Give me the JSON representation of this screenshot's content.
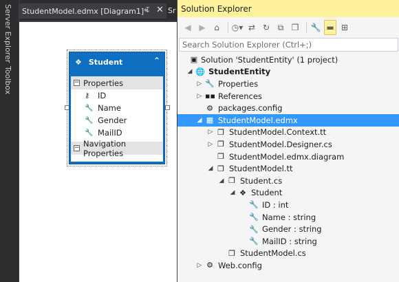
{
  "left_strip": {
    "server_explorer": "Server Explorer",
    "toolbox": "Toolbox"
  },
  "designer": {
    "tab_title": "StudentModel.edmx [Diagram1]*",
    "pin_glyph": "↧",
    "close_glyph": "✕",
    "next_tab_fragment": "Sr",
    "entity": {
      "name": "Student",
      "properties_label": "Properties",
      "properties": [
        "ID",
        "Name",
        "Gender",
        "MailID"
      ],
      "navigation_label": "Navigation Properties"
    }
  },
  "solution_explorer": {
    "title": "Solution Explorer",
    "search_placeholder": "Search Solution Explorer (Ctrl+;)",
    "toolbar_icons": [
      "back-icon",
      "forward-icon",
      "home-icon",
      "pending-changes-icon",
      "sync-icon",
      "refresh-icon",
      "collapse-all-icon",
      "show-all-files-icon",
      "properties-icon",
      "preview-icon",
      "class-view-icon"
    ],
    "tree": [
      {
        "label": "Solution 'StudentEntity' (1 project)",
        "level": 0,
        "expander": "",
        "icon": "solution-icon",
        "glyph": "▣",
        "bold": false,
        "selected": false
      },
      {
        "label": "StudentEntity",
        "level": 0,
        "expander": "◢",
        "icon": "web-project-icon",
        "glyph": "🌐",
        "bold": true,
        "selected": false
      },
      {
        "label": "Properties",
        "level": 1,
        "expander": "▷",
        "icon": "wrench-icon",
        "glyph": "🔧",
        "bold": false,
        "selected": false
      },
      {
        "label": "References",
        "level": 1,
        "expander": "▷",
        "icon": "references-icon",
        "glyph": "▪▪",
        "bold": false,
        "selected": false
      },
      {
        "label": "packages.config",
        "level": 1,
        "expander": "",
        "icon": "config-file-icon",
        "glyph": "⚙",
        "bold": false,
        "selected": false
      },
      {
        "label": "StudentModel.edmx",
        "level": 1,
        "expander": "◢",
        "icon": "edmx-file-icon",
        "glyph": "▦",
        "bold": false,
        "selected": true
      },
      {
        "label": "StudentModel.Context.tt",
        "level": 2,
        "expander": "▷",
        "icon": "tt-file-icon",
        "glyph": "❐",
        "bold": false,
        "selected": false
      },
      {
        "label": "StudentModel.Designer.cs",
        "level": 2,
        "expander": "▷",
        "icon": "cs-file-icon",
        "glyph": "❐",
        "bold": false,
        "selected": false
      },
      {
        "label": "StudentModel.edmx.diagram",
        "level": 2,
        "expander": "",
        "icon": "diagram-file-icon",
        "glyph": "❐",
        "bold": false,
        "selected": false
      },
      {
        "label": "StudentModel.tt",
        "level": 2,
        "expander": "◢",
        "icon": "tt-file-icon",
        "glyph": "❐",
        "bold": false,
        "selected": false
      },
      {
        "label": "Student.cs",
        "level": 3,
        "expander": "◢",
        "icon": "cs-file-icon",
        "glyph": "❐",
        "bold": false,
        "selected": false
      },
      {
        "label": "Student",
        "level": 4,
        "expander": "◢",
        "icon": "class-icon",
        "glyph": "❖",
        "bold": false,
        "selected": false
      },
      {
        "label": "ID : int",
        "level": 5,
        "expander": "",
        "icon": "property-wrench-icon",
        "glyph": "🔧",
        "bold": false,
        "selected": false
      },
      {
        "label": "Name : string",
        "level": 5,
        "expander": "",
        "icon": "property-wrench-icon",
        "glyph": "🔧",
        "bold": false,
        "selected": false
      },
      {
        "label": "Gender : string",
        "level": 5,
        "expander": "",
        "icon": "property-wrench-icon",
        "glyph": "🔧",
        "bold": false,
        "selected": false
      },
      {
        "label": "MailID : string",
        "level": 5,
        "expander": "",
        "icon": "property-wrench-icon",
        "glyph": "🔧",
        "bold": false,
        "selected": false
      },
      {
        "label": "StudentModel.cs",
        "level": 3,
        "expander": "",
        "icon": "cs-file-icon",
        "glyph": "❐",
        "bold": false,
        "selected": false
      },
      {
        "label": "Web.config",
        "level": 1,
        "expander": "▷",
        "icon": "config-file-icon",
        "glyph": "⚙",
        "bold": false,
        "selected": false
      }
    ]
  },
  "colors": {
    "accent_blue": "#0e6fc1",
    "selection_blue": "#3399ff",
    "title_yellow": "#fff29d",
    "dark_chrome": "#2d2d30"
  }
}
